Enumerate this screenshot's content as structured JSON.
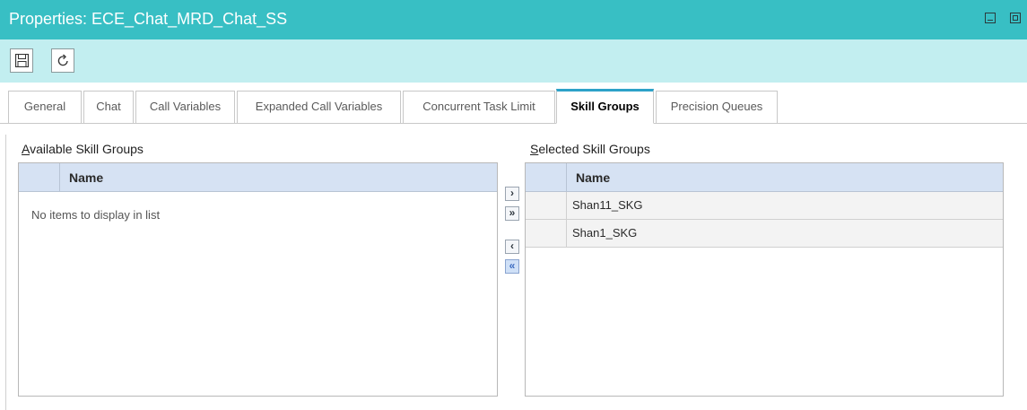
{
  "window": {
    "title": "Properties: ECE_Chat_MRD_Chat_SS"
  },
  "toolbar": {
    "save_icon": "save-icon",
    "refresh_icon": "refresh-icon"
  },
  "tabs": [
    {
      "label": "General"
    },
    {
      "label": "Chat"
    },
    {
      "label": "Call Variables"
    },
    {
      "label": "Expanded Call Variables"
    },
    {
      "label": "Concurrent Task Limit"
    },
    {
      "label": "Skill Groups"
    },
    {
      "label": "Precision Queues"
    }
  ],
  "active_tab": "Skill Groups",
  "available": {
    "label_accel": "A",
    "label_rest": "vailable Skill Groups",
    "column": "Name",
    "empty_message": "No items to display in list",
    "items": []
  },
  "selected": {
    "label_accel": "S",
    "label_rest": "elected Skill Groups",
    "column": "Name",
    "items": [
      "Shan11_SKG",
      "Shan1_SKG"
    ]
  },
  "move_buttons": [
    {
      "glyph": "›",
      "icon": "move-right-icon"
    },
    {
      "glyph": "»",
      "icon": "move-all-right-icon"
    },
    {
      "glyph": "‹",
      "icon": "move-left-icon"
    },
    {
      "glyph": "«",
      "icon": "move-all-left-icon"
    }
  ],
  "colors": {
    "titlebar": "#38bfc4",
    "toolbar": "#c2eef0",
    "active_tab_accent": "#2da2c8",
    "list_header": "#d6e2f3"
  }
}
